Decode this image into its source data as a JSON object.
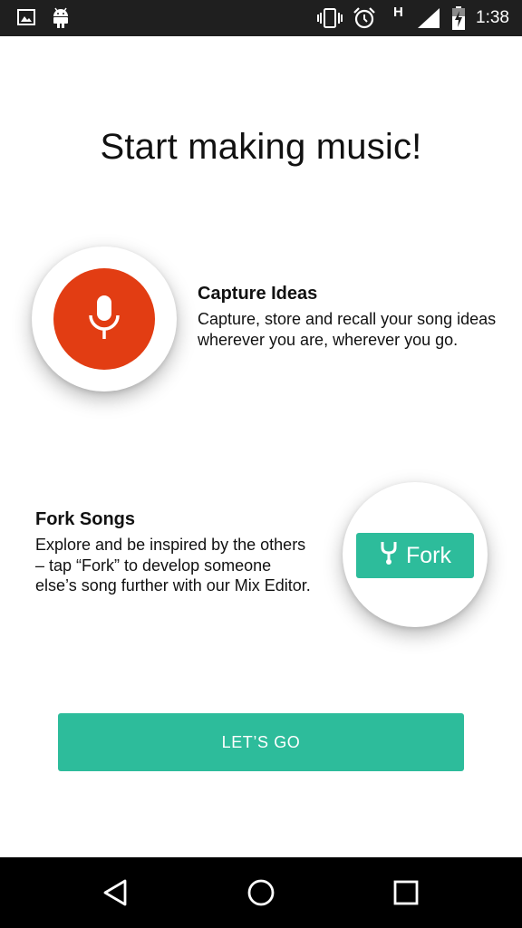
{
  "status_bar": {
    "network_type": "H",
    "time": "1:38"
  },
  "title": "Start making music!",
  "features": {
    "capture": {
      "heading": "Capture Ideas",
      "body": "Capture, store and recall your song ideas wherever you are, wherever you go."
    },
    "fork": {
      "heading": "Fork Songs",
      "body": "Explore and be inspired by the others – tap “Fork” to develop someone else’s song further with our Mix Editor.",
      "chip_label": "Fork"
    }
  },
  "cta": {
    "label": "LET’S GO"
  },
  "colors": {
    "accent": "#2dbc9b",
    "mic_red": "#e23d13",
    "status_bar": "#1f1f1f",
    "nav_bar": "#000000"
  },
  "icons": [
    "gallery-icon",
    "android-icon",
    "vibrate-icon",
    "alarm-icon",
    "signal-icon",
    "battery-icon",
    "microphone-icon",
    "fork-icon",
    "back-icon",
    "home-icon",
    "recents-icon"
  ]
}
